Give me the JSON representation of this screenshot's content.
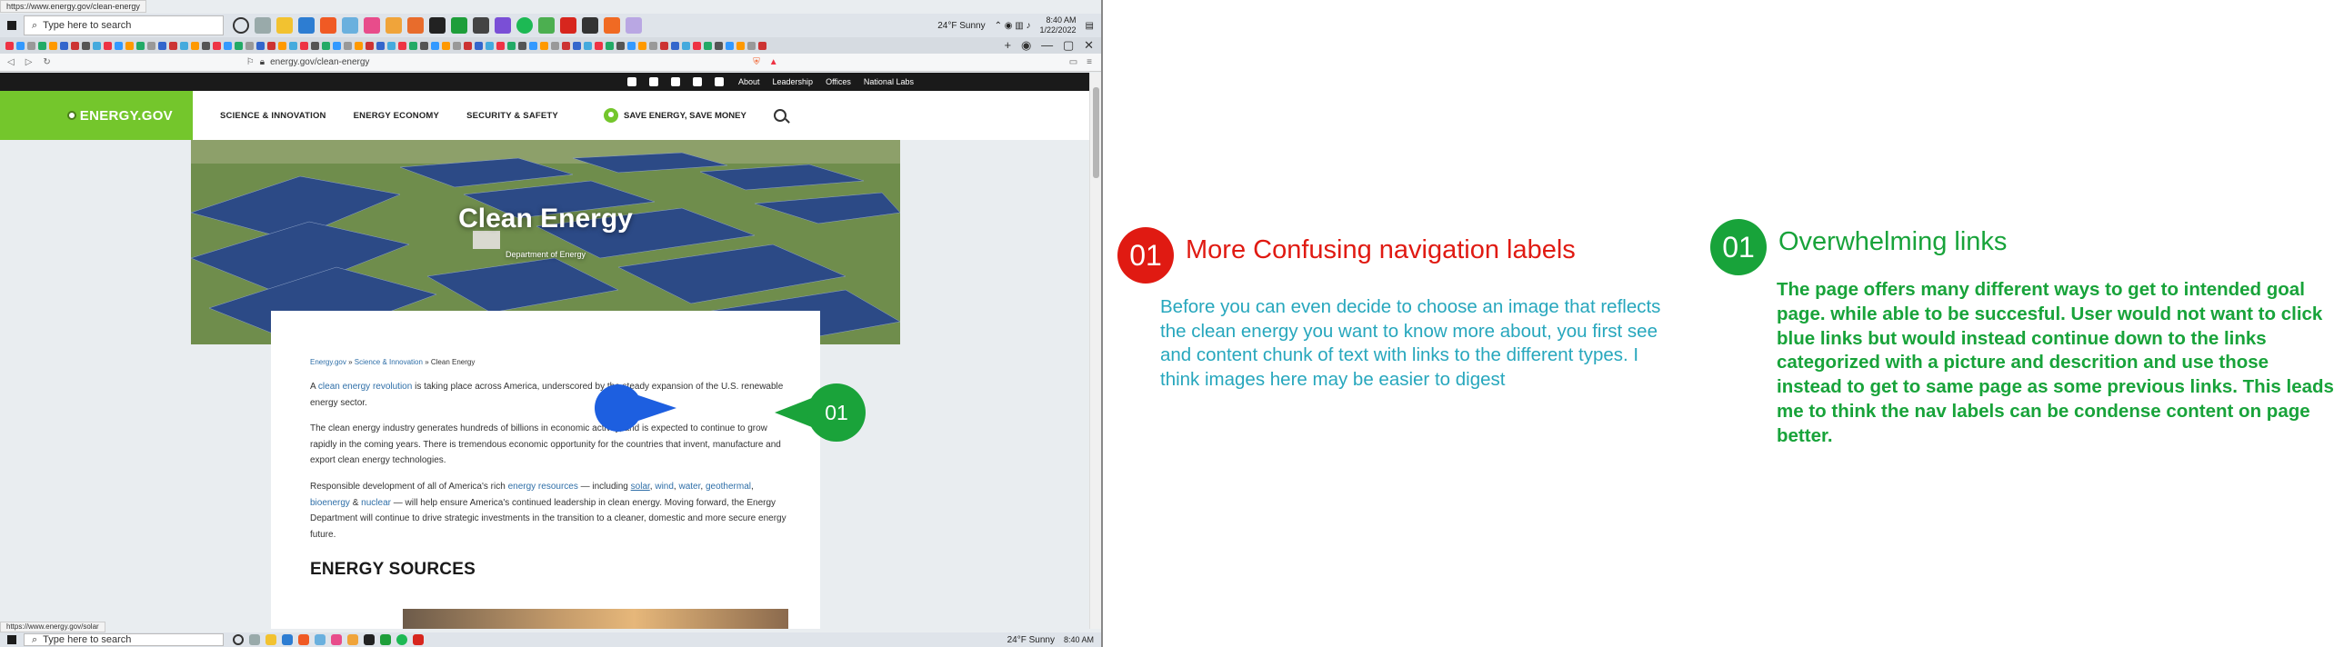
{
  "browser": {
    "status_url_top": "https://www.energy.gov/clean-energy",
    "status_url_bottom": "https://www.energy.gov/solar",
    "address_url": "energy.gov/clean-energy",
    "taskbar": {
      "search_placeholder": "Type here to search",
      "weather": "24°F  Sunny",
      "time": "8:40 AM",
      "date": "1/22/2022"
    }
  },
  "site": {
    "logo_text": "ENERGY.GOV",
    "utility_links": [
      "About",
      "Leadership",
      "Offices",
      "National Labs"
    ],
    "nav": [
      "SCIENCE & INNOVATION",
      "ENERGY ECONOMY",
      "SECURITY & SAFETY"
    ],
    "save_energy": "SAVE ENERGY, SAVE MONEY",
    "hero_title": "Clean Energy",
    "hero_subtitle": "Department of Energy",
    "breadcrumb": [
      "Energy.gov",
      "Science & Innovation",
      "Clean Energy"
    ],
    "paragraphs": {
      "p1_a": "A ",
      "p1_link": "clean energy revolution",
      "p1_b": " is taking place across America, underscored by the steady expansion of the U.S. renewable energy sector.",
      "p2": "The clean energy industry generates hundreds of billions in economic activity, and is expected to continue to grow rapidly in the coming years. There is tremendous economic opportunity for the countries that invent, manufacture and export clean energy technologies.",
      "p3_a": "Responsible development of all of America's rich ",
      "p3_link_resources": "energy resources",
      "p3_b": " — including ",
      "p3_link_solar": "solar",
      "p3_link_wind": "wind",
      "p3_link_water": "water",
      "p3_link_geothermal": "geothermal",
      "p3_link_bioenergy": "bioenergy",
      "p3_link_nuclear": "nuclear",
      "p3_c": " — will help ensure America's continued leadership in clean energy. Moving forward, the Energy Department will continue to drive strategic investments in the transition to a cleaner, domestic and more secure energy future."
    },
    "section_heading": "ENERGY SOURCES"
  },
  "markers": {
    "green_number": "01"
  },
  "annotations": {
    "left": {
      "number": "01",
      "title": "More Confusing navigation labels",
      "body": "Before you can even decide to choose an image that reflects the clean energy you want to know more about, you first see and content chunk of text with links to the different types. I think images here may be easier to digest"
    },
    "right": {
      "number": "01",
      "title": "Overwhelming links",
      "body": "The page offers many different ways to get to intended goal page. while able to be succesful. User would not want to click blue links but would instead continue down to the links categorized with a picture and descrition and use those instead to get to same page as some previous links. This leads me to think the nav labels can be condense content on page better."
    }
  },
  "colors": {
    "brand_green": "#74c62c",
    "annotation_red": "#e01a12",
    "annotation_teal": "#27a7bd",
    "annotation_green": "#18a33a",
    "cursor_blue": "#1d5fe0"
  }
}
